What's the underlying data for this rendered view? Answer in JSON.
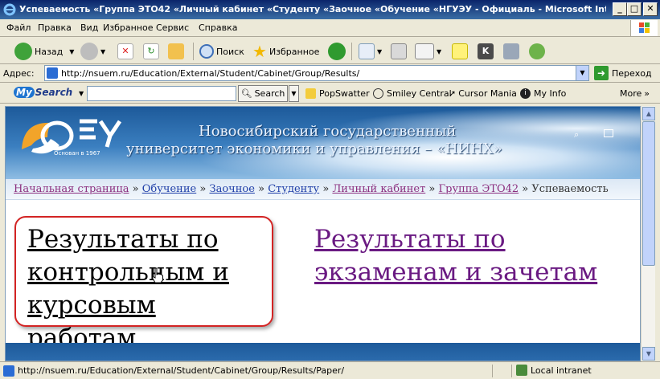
{
  "window": {
    "title": "Успеваемость «Группа ЭТО42 «Личный кабинет «Студенту «Заочное «Обучение «НГУЭУ - Официаль - Microsoft Internet ...",
    "min": "_",
    "max": "□",
    "close": "✕"
  },
  "menu": [
    "Файл",
    "Правка",
    "Вид",
    "Избранное",
    "Сервис",
    "Справка"
  ],
  "toolbar": {
    "back_label": "Назад",
    "search_label": "Поиск",
    "favorites_label": "Избранное"
  },
  "address": {
    "label": "Адрес:",
    "url": "http://nsuem.ru/Education/External/Student/Cabinet/Group/Results/",
    "go_label": "Переход"
  },
  "links_bar": {
    "mysearch_my": "My",
    "mysearch_rest": "Search",
    "search_button": "Search",
    "items": [
      "PopSwatter",
      "Smiley Central",
      "Cursor Mania",
      "My Info"
    ],
    "more": "More"
  },
  "page": {
    "banner": {
      "line1": "Новосибирский государственный",
      "line2": "университет экономики и управления – «НИНХ»",
      "founded": "Основан в 1967"
    },
    "breadcrumb": {
      "items": [
        "Начальная страница",
        "Обучение",
        "Заочное",
        "Студенту",
        "Личный кабинет",
        "Группа ЭТО42"
      ],
      "separator": "»",
      "current": "Успеваемость"
    },
    "link_tests": "Результаты по контрольным и курсовым работам",
    "link_exams": "Результаты по экзаменам и зачетам"
  },
  "status": {
    "url": "http://nsuem.ru/Education/External/Student/Cabinet/Group/Results/Paper/",
    "zone": "Local intranet"
  },
  "colors": {
    "visited_link": "#6a1a82",
    "highlight_border": "#d32424",
    "banner_blue": "#1d5a9a"
  }
}
